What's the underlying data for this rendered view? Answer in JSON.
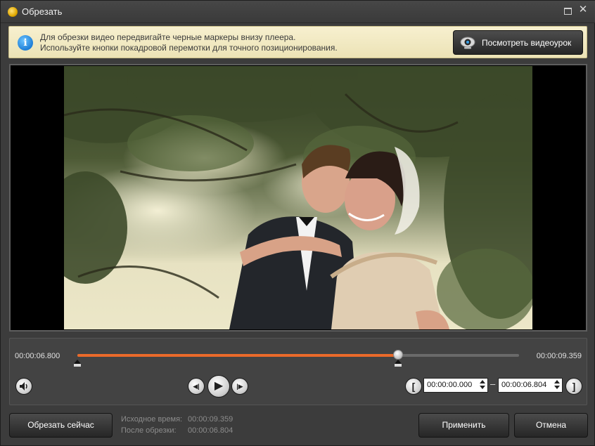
{
  "window": {
    "title": "Обрезать",
    "close_glyph": "✕"
  },
  "info": {
    "line1": "Для обрезки видео передвигайте черные маркеры внизу плеера.",
    "line2": "Используйте кнопки покадровой перемотки для точного позиционирования.",
    "icon_glyph": "i",
    "tutorial_button": "Посмотреть видеоурок"
  },
  "player": {
    "start_time": "00:00:06.800",
    "end_time": "00:00:09.359",
    "progress_fraction": 0.726,
    "start_marker_fraction": 0.0,
    "end_marker_fraction": 0.726,
    "accent_color": "#ea6a2a"
  },
  "controls": {
    "volume_icon": "speaker-icon",
    "prev_frame_glyph": "◀|",
    "play_glyph": "▶",
    "next_frame_glyph": "|▶",
    "set_start_glyph": "[",
    "set_end_glyph": "]",
    "range_start": "00:00:00.000",
    "range_separator": "–",
    "range_end": "00:00:06.804"
  },
  "footer": {
    "trim_now": "Обрезать сейчас",
    "original_label": "Исходное время:",
    "original_value": "00:00:09.359",
    "after_label": "После обрезки:",
    "after_value": "00:00:06.804",
    "apply": "Применить",
    "cancel": "Отмена"
  }
}
